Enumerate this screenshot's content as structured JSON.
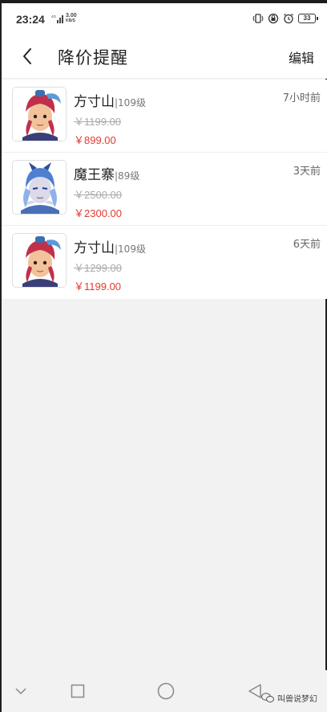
{
  "status_bar": {
    "time": "23:24",
    "net_speed_value": "3.00",
    "net_speed_unit": "KB/S",
    "network": "4G",
    "battery": "33"
  },
  "header": {
    "title": "降价提醒",
    "edit_label": "编辑"
  },
  "items": [
    {
      "name": "方寸山",
      "level": "|109级",
      "old_price": "￥1199.00",
      "new_price": "￥899.00",
      "time": "7小时前",
      "avatar": "fangcunshan-avatar",
      "hair": "#c0304a"
    },
    {
      "name": "魔王寨",
      "level": "|89级",
      "old_price": "￥2500.00",
      "new_price": "￥2300.00",
      "time": "3天前",
      "avatar": "mowangzhai-avatar",
      "hair": "#4f7fd0"
    },
    {
      "name": "方寸山",
      "level": "|109级",
      "old_price": "￥1299.00",
      "new_price": "￥1199.00",
      "time": "6天前",
      "avatar": "fangcunshan-avatar",
      "hair": "#c0304a"
    }
  ],
  "nav_bar": {
    "watermark": "叫兽说梦幻"
  },
  "colors": {
    "price_red": "#e23b2f",
    "background": "#f2f2f2"
  }
}
